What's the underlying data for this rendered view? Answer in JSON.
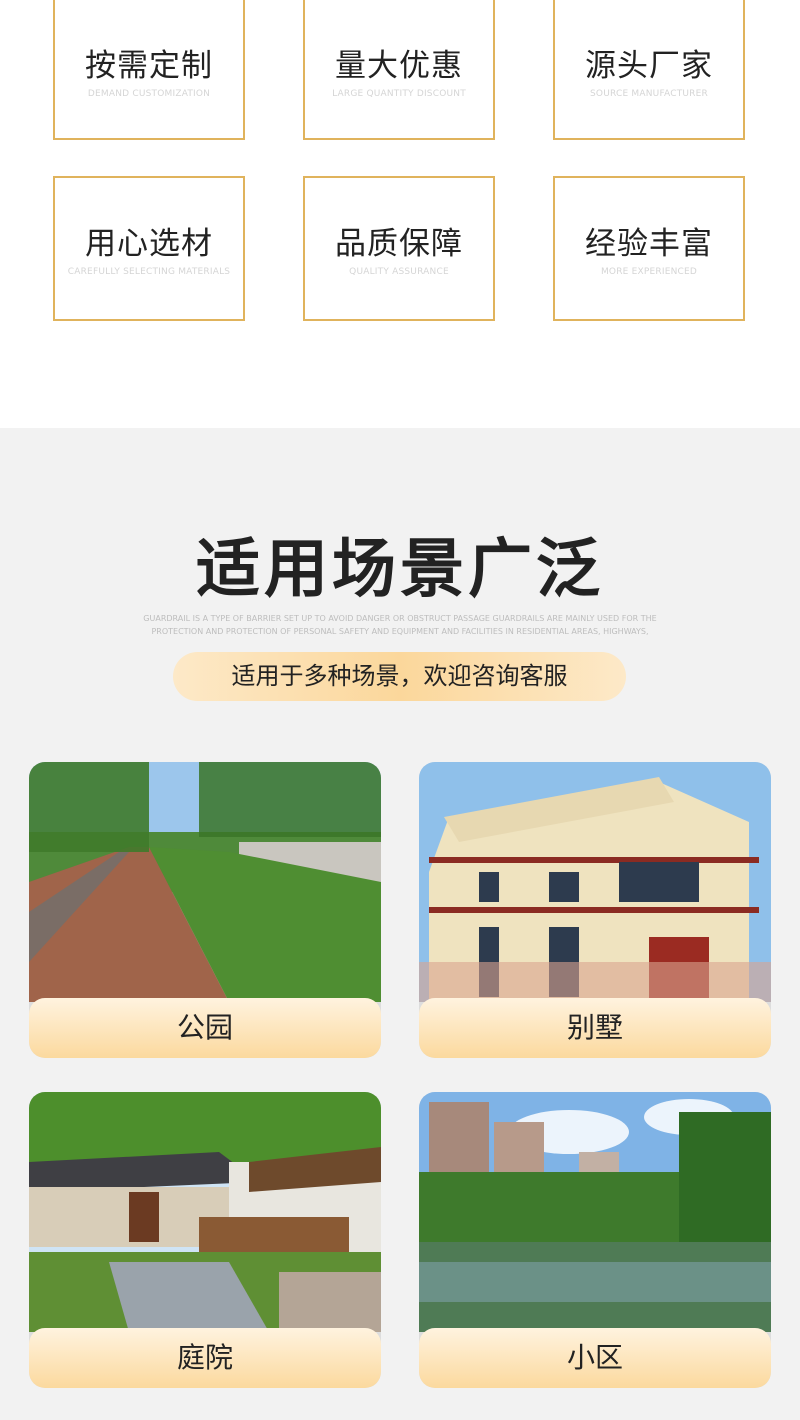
{
  "features": [
    {
      "title": "按需定制",
      "subtitle": "DEMAND CUSTOMIZATION"
    },
    {
      "title": "量大优惠",
      "subtitle": "LARGE QUANTITY DISCOUNT"
    },
    {
      "title": "源头厂家",
      "subtitle": "SOURCE MANUFACTURER"
    },
    {
      "title": "用心选材",
      "subtitle": "CAREFULLY SELECTING MATERIALS"
    },
    {
      "title": "品质保障",
      "subtitle": "QUALITY ASSURANCE"
    },
    {
      "title": "经验丰富",
      "subtitle": "MORE EXPERIENCED"
    }
  ],
  "scenes": {
    "title": "适用场景广泛",
    "description": "GUARDRAIL IS A TYPE OF BARRIER SET UP TO AVOID DANGER OR OBSTRUCT PASSAGE GUARDRAILS ARE MAINLY USED FOR THE PROTECTION AND PROTECTION OF PERSONAL SAFETY AND EQUIPMENT AND FACILITIES IN RESIDENTIAL AREAS, HIGHWAYS,",
    "pill": "适用于多种场景，欢迎咨询客服",
    "items": [
      {
        "label": "公园"
      },
      {
        "label": "别墅"
      },
      {
        "label": "庭院"
      },
      {
        "label": "小区"
      }
    ]
  },
  "colors": {
    "card_border": "#e0b35c",
    "section_bg": "#f2f2f2",
    "label_gradient_top": "#fff3df",
    "label_gradient_bottom": "#fbd99e"
  }
}
